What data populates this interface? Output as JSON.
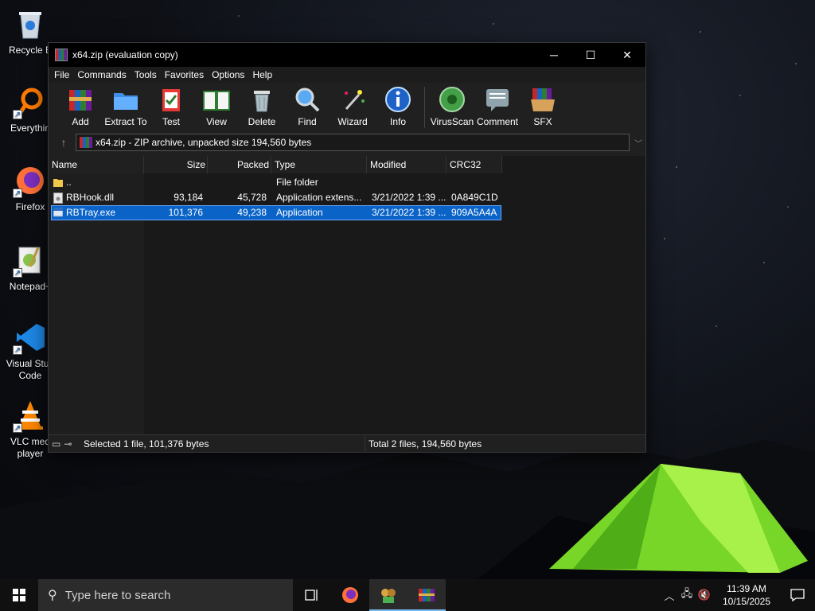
{
  "desktop": {
    "icons": [
      {
        "label": "Recycle B",
        "name": "recycle-bin"
      },
      {
        "label": "Everythin",
        "name": "everything"
      },
      {
        "label": "Firefox",
        "name": "firefox"
      },
      {
        "label": "Notepad+",
        "name": "notepad-plus-plus"
      },
      {
        "label": "Visual Stud Code",
        "name": "visual-studio-code"
      },
      {
        "label": "VLC med player",
        "name": "vlc-media-player"
      }
    ]
  },
  "window": {
    "title": "x64.zip (evaluation copy)",
    "controls": {
      "minimize": "─",
      "maximize": "☐",
      "close": "✕"
    },
    "menu": [
      "File",
      "Commands",
      "Tools",
      "Favorites",
      "Options",
      "Help"
    ],
    "toolbar": [
      {
        "label": "Add",
        "icon": "add-archive-icon"
      },
      {
        "label": "Extract To",
        "icon": "extract-folder-icon"
      },
      {
        "label": "Test",
        "icon": "test-clipboard-icon"
      },
      {
        "label": "View",
        "icon": "view-book-icon"
      },
      {
        "label": "Delete",
        "icon": "trash-icon"
      },
      {
        "label": "Find",
        "icon": "magnifier-icon"
      },
      {
        "label": "Wizard",
        "icon": "wand-icon"
      },
      {
        "label": "Info",
        "icon": "info-icon"
      },
      {
        "label": "VirusScan",
        "icon": "virus-scan-icon"
      },
      {
        "label": "Comment",
        "icon": "comment-icon"
      },
      {
        "label": "SFX",
        "icon": "sfx-box-icon"
      }
    ],
    "address": "x64.zip - ZIP archive, unpacked size 194,560 bytes",
    "columns": {
      "name": "Name",
      "size": "Size",
      "packed": "Packed",
      "type": "Type",
      "modified": "Modified",
      "crc": "CRC32"
    },
    "files": [
      {
        "name": "..",
        "size": "",
        "packed": "",
        "type": "File folder",
        "modified": "",
        "crc": "",
        "icon": "folder-icon",
        "selected": false
      },
      {
        "name": "RBHook.dll",
        "size": "93,184",
        "packed": "45,728",
        "type": "Application extens...",
        "modified": "3/21/2022 1:39 ...",
        "crc": "0A849C1D",
        "icon": "dll-file-icon",
        "selected": false
      },
      {
        "name": "RBTray.exe",
        "size": "101,376",
        "packed": "49,238",
        "type": "Application",
        "modified": "3/21/2022 1:39 ...",
        "crc": "909A5A4A",
        "icon": "exe-file-icon",
        "selected": true
      }
    ],
    "status": {
      "left": "Selected 1 file, 101,376 bytes",
      "right": "Total 2 files, 194,560 bytes"
    }
  },
  "taskbar": {
    "search_placeholder": "Type here to search",
    "clock_time": "11:39 AM",
    "clock_date": "10/15/2025"
  }
}
